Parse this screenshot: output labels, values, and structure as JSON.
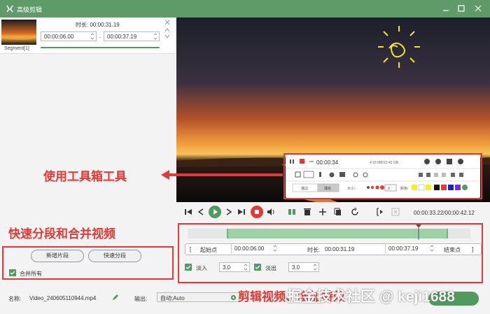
{
  "window": {
    "title": "高级剪辑"
  },
  "segment": {
    "label": "Segment[1]",
    "duration_label": "时长:",
    "duration_value": "00:00:31.19",
    "start_time": "00:00:06.00",
    "end_time": "00:00:37.19",
    "separator": "-"
  },
  "left_actions": {
    "new_segment": "新增片段",
    "quick_split": "快速分段",
    "merge_all": "合并所有"
  },
  "annotations": {
    "quick_split_merge": "快速分段和合并视频",
    "toolbox": "使用工具箱工具",
    "edit_effects": "剪辑视频、增加特效"
  },
  "tool_panel": {
    "time": "00:00:34",
    "info": "4:16 MB/12:42 GB",
    "tab_outline": "描边",
    "tab_fill": "填充",
    "size_label": "大小:",
    "size_value": "3",
    "color_label": "颜色:"
  },
  "playback": {
    "current_time": "00:00:33.22",
    "total_time": "00:00:42.12",
    "sep": "/"
  },
  "edit": {
    "start_bracket": "[",
    "start_point_label": "起始点",
    "start_value": "00:00:06.00",
    "duration_label": "时长:",
    "duration_value": "00:00:31.19",
    "end_value": "00:00:37.19",
    "end_point_label": "结束点",
    "end_bracket": "]",
    "fade_in_label": "淡入",
    "fade_in_value": "3.0",
    "fade_out_label": "淡出",
    "fade_out_value": "3.0"
  },
  "bottom": {
    "name_label": "名称:",
    "file_name": "Video_240605110944.mp4",
    "output_label": "输出:",
    "output_value": "自动;Auto"
  },
  "watermark": "掘金技术社区 @ keji1688",
  "colors": {
    "accent": "#5f9a69",
    "annotation": "#e53935",
    "slider": "#9ed1a6"
  }
}
